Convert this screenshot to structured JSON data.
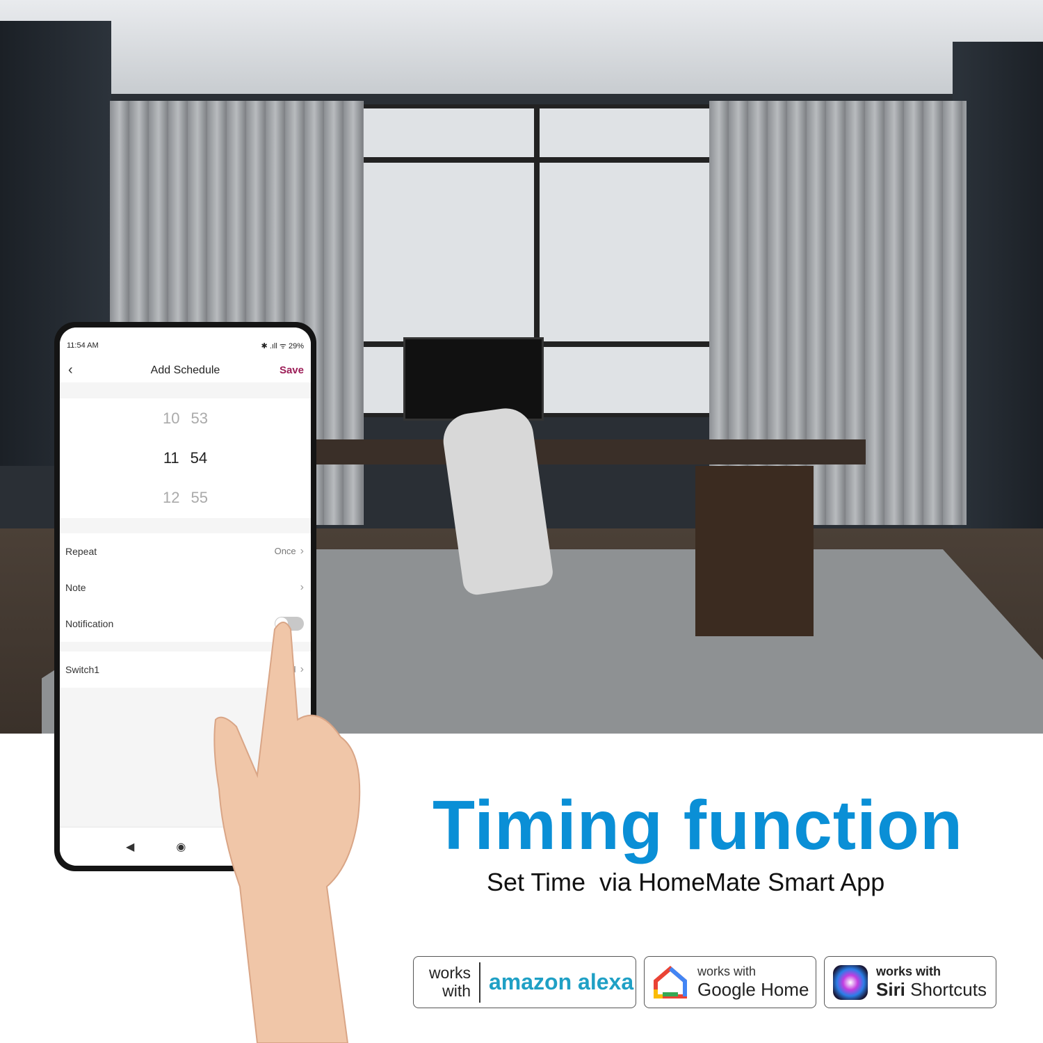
{
  "phone": {
    "status_time": "11:54 AM",
    "status_right": "✱ .ıll ᯤ 29%",
    "title": "Add Schedule",
    "save_label": "Save",
    "picker": [
      {
        "hour": "10",
        "minute": "53"
      },
      {
        "hour": "11",
        "minute": "54"
      },
      {
        "hour": "12",
        "minute": "55"
      }
    ],
    "repeat_label": "Repeat",
    "repeat_value": "Once",
    "note_label": "Note",
    "notification_label": "Notification",
    "notification_on": false,
    "switch_label": "Switch1",
    "switch_value": "N"
  },
  "headline": "Timing function",
  "subheadline": "Set Time  via HomeMate Smart App",
  "badges": {
    "alexa_works": "works",
    "alexa_with": "with",
    "alexa_brand": "amazon alexa",
    "google_works": "works with",
    "google_brand": "Google Home",
    "siri_works": "works with",
    "siri_brand_bold": "Siri",
    "siri_brand": "Shortcuts"
  }
}
